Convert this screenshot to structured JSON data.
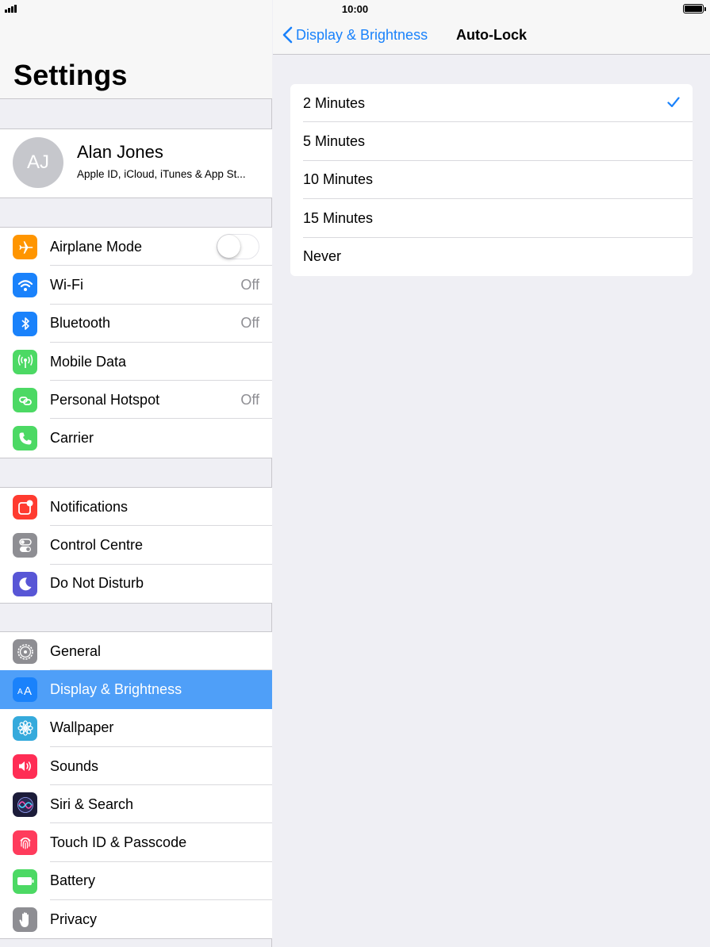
{
  "status_bar": {
    "time": "10:00"
  },
  "master": {
    "title": "Settings",
    "profile": {
      "initials": "AJ",
      "name": "Alan Jones",
      "subtitle": "Apple ID, iCloud, iTunes & App St..."
    },
    "group1": [
      {
        "label": "Airplane Mode",
        "value": "",
        "icon": "airplane-icon",
        "color": "#ff9500"
      },
      {
        "label": "Wi-Fi",
        "value": "Off",
        "icon": "wifi-icon",
        "color": "#1a82fb"
      },
      {
        "label": "Bluetooth",
        "value": "Off",
        "icon": "bluetooth-icon",
        "color": "#1a82fb"
      },
      {
        "label": "Mobile Data",
        "value": "",
        "icon": "antenna-icon",
        "color": "#4cd964"
      },
      {
        "label": "Personal Hotspot",
        "value": "Off",
        "icon": "hotspot-icon",
        "color": "#4cd964"
      },
      {
        "label": "Carrier",
        "value": "",
        "icon": "phone-icon",
        "color": "#4cd964"
      }
    ],
    "group2": [
      {
        "label": "Notifications",
        "icon": "notifications-icon",
        "color": "#ff3b30"
      },
      {
        "label": "Control Centre",
        "icon": "control-centre-icon",
        "color": "#8e8e93"
      },
      {
        "label": "Do Not Disturb",
        "icon": "moon-icon",
        "color": "#5856d6"
      }
    ],
    "group3": [
      {
        "label": "General",
        "icon": "gear-icon",
        "color": "#8e8e93"
      },
      {
        "label": "Display & Brightness",
        "icon": "text-size-icon",
        "color": "#1a82fb",
        "selected": true
      },
      {
        "label": "Wallpaper",
        "icon": "flower-icon",
        "color": "#35aadc"
      },
      {
        "label": "Sounds",
        "icon": "speaker-icon",
        "color": "#ff2d55"
      },
      {
        "label": "Siri & Search",
        "icon": "siri-icon",
        "color": "#1c1c3a"
      },
      {
        "label": "Touch ID & Passcode",
        "icon": "fingerprint-icon",
        "color": "#ff3b5c"
      },
      {
        "label": "Battery",
        "icon": "battery-icon",
        "color": "#4cd964"
      },
      {
        "label": "Privacy",
        "icon": "hand-icon",
        "color": "#8e8e93"
      }
    ]
  },
  "detail": {
    "back_label": "Display & Brightness",
    "title": "Auto-Lock",
    "options": [
      {
        "label": "2 Minutes",
        "checked": true
      },
      {
        "label": "5 Minutes",
        "checked": false
      },
      {
        "label": "10 Minutes",
        "checked": false
      },
      {
        "label": "15 Minutes",
        "checked": false
      },
      {
        "label": "Never",
        "checked": false
      }
    ],
    "accent": "#1a82fb"
  }
}
